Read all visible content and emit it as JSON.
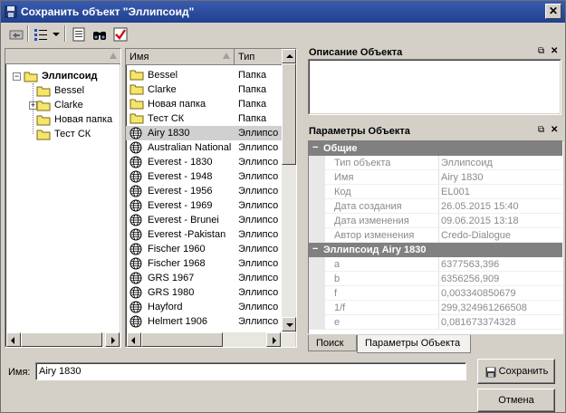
{
  "window": {
    "title": "Сохранить объект \"Эллипсоид\"",
    "close_label": "✕"
  },
  "tree": {
    "root": "Эллипсоид",
    "children": [
      "Bessel",
      "Clarke",
      "Новая папка",
      "Тест СК"
    ]
  },
  "list": {
    "columns": [
      "Имя",
      "Тип"
    ],
    "rows": [
      {
        "name": "Bessel",
        "type": "Папка",
        "icon": "folder"
      },
      {
        "name": "Clarke",
        "type": "Папка",
        "icon": "folder"
      },
      {
        "name": "Новая папка",
        "type": "Папка",
        "icon": "folder"
      },
      {
        "name": "Тест СК",
        "type": "Папка",
        "icon": "folder"
      },
      {
        "name": "Airy 1830",
        "type": "Эллипсо",
        "icon": "globe"
      },
      {
        "name": "Australian National",
        "type": "Эллипсо",
        "icon": "globe"
      },
      {
        "name": "Everest - 1830",
        "type": "Эллипсо",
        "icon": "globe"
      },
      {
        "name": "Everest - 1948",
        "type": "Эллипсо",
        "icon": "globe"
      },
      {
        "name": "Everest - 1956",
        "type": "Эллипсо",
        "icon": "globe"
      },
      {
        "name": "Everest - 1969",
        "type": "Эллипсо",
        "icon": "globe"
      },
      {
        "name": "Everest - Brunei",
        "type": "Эллипсо",
        "icon": "globe"
      },
      {
        "name": "Everest -Pakistan",
        "type": "Эллипсо",
        "icon": "globe"
      },
      {
        "name": "Fischer 1960",
        "type": "Эллипсо",
        "icon": "globe"
      },
      {
        "name": "Fischer 1968",
        "type": "Эллипсо",
        "icon": "globe"
      },
      {
        "name": "GRS 1967",
        "type": "Эллипсо",
        "icon": "globe"
      },
      {
        "name": "GRS 1980",
        "type": "Эллипсо",
        "icon": "globe"
      },
      {
        "name": "Hayford",
        "type": "Эллипсо",
        "icon": "globe"
      },
      {
        "name": "Helmert 1906",
        "type": "Эллипсо",
        "icon": "globe"
      }
    ]
  },
  "description_panel": {
    "title": "Описание Объекта"
  },
  "params_panel": {
    "title": "Параметры Объекта",
    "groups": [
      {
        "name": "Общие",
        "props": [
          {
            "key": "Тип объекта",
            "value": "Эллипсоид"
          },
          {
            "key": "Имя",
            "value": "Airy 1830"
          },
          {
            "key": "Код",
            "value": "EL001"
          },
          {
            "key": "Дата создания",
            "value": "26.05.2015 15:40"
          },
          {
            "key": "Дата изменения",
            "value": "09.06.2015 13:18"
          },
          {
            "key": "Автор изменения",
            "value": "Credo-Dialogue"
          }
        ]
      },
      {
        "name": "Эллипсоид Airy 1830",
        "props": [
          {
            "key": "a",
            "value": "6377563,396"
          },
          {
            "key": "b",
            "value": "6356256,909"
          },
          {
            "key": "f",
            "value": "0,003340850679"
          },
          {
            "key": "1/f",
            "value": "299,324961266508"
          },
          {
            "key": "e",
            "value": "0,081673374328"
          }
        ]
      }
    ]
  },
  "tabs": [
    "Поиск",
    "Параметры Объекта"
  ],
  "name_field": {
    "label": "Имя:",
    "value": "Airy 1830"
  },
  "buttons": {
    "save": "Сохранить",
    "cancel": "Отмена"
  }
}
